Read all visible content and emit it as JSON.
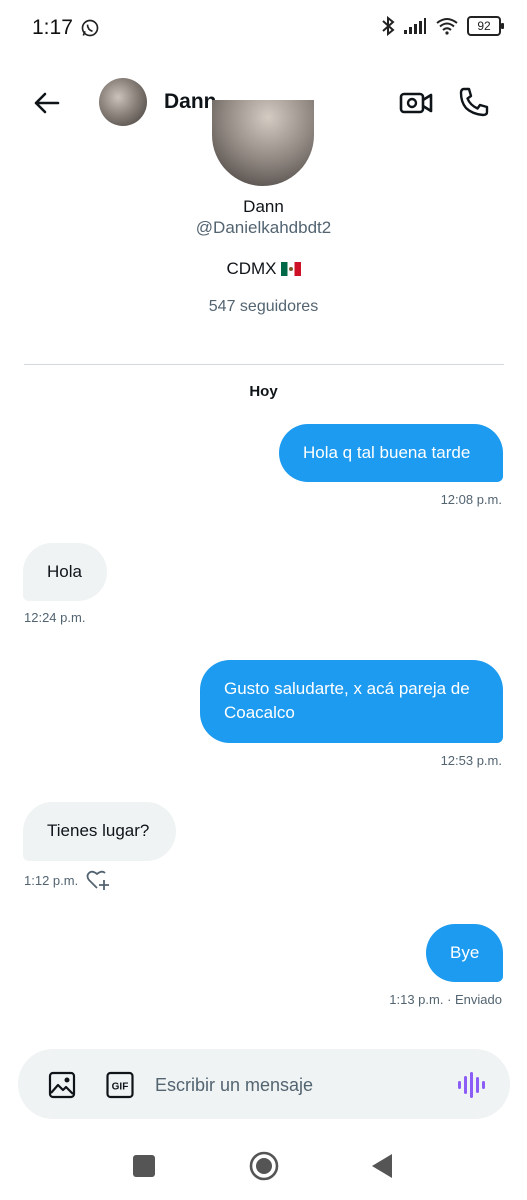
{
  "status_bar": {
    "time": "1:17",
    "battery": "92",
    "icons": [
      "whatsapp-icon",
      "bluetooth-icon",
      "signal-icon",
      "wifi-icon",
      "battery-icon"
    ]
  },
  "header": {
    "name": "Dann",
    "icons": [
      "back-arrow-icon",
      "video-call-icon",
      "phone-icon"
    ]
  },
  "profile": {
    "name": "Dann",
    "handle": "@Danielkahdbdt2",
    "location": "CDMX",
    "followers": "547 seguidores"
  },
  "conversation": {
    "day_label": "Hoy",
    "messages": [
      {
        "direction": "out",
        "text": "Hola q tal buena tarde",
        "time": "12:08 p.m."
      },
      {
        "direction": "in",
        "text": "Hola",
        "time": "12:24 p.m."
      },
      {
        "direction": "out",
        "text": "Gusto saludarte, x acá pareja de Coacalco",
        "time": "12:53 p.m."
      },
      {
        "direction": "in",
        "text": "Tienes lugar?",
        "time": "1:12 p.m."
      },
      {
        "direction": "out",
        "text": "Bye",
        "time": "1:13 p.m. · Enviado"
      }
    ]
  },
  "composer": {
    "placeholder": "Escribir un mensaje",
    "gif_label": "GIF"
  },
  "colors": {
    "accent": "#1d9bf0",
    "incoming_bubble": "#eff3f4",
    "secondary_text": "#536471",
    "voice_icon": "#8b5cf6"
  }
}
